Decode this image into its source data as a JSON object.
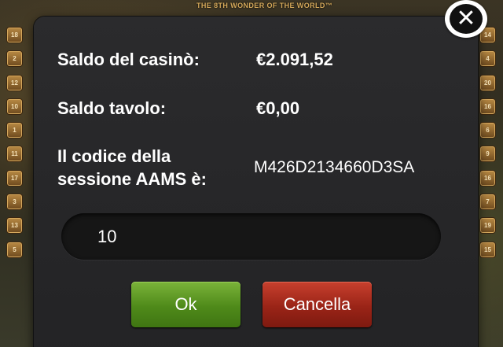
{
  "background": {
    "game_title": "THE 8TH WONDER OF THE WORLD™",
    "left_paylines": [
      "18",
      "2",
      "12",
      "10",
      "1",
      "11",
      "17",
      "3",
      "13",
      "5"
    ],
    "right_paylines": [
      "14",
      "4",
      "20",
      "16",
      "6",
      "9",
      "16",
      "7",
      "19",
      "15"
    ]
  },
  "dialog": {
    "close_icon": "✕",
    "casino_balance_label": "Saldo del casinò:",
    "casino_balance_value": "€2.091,52",
    "table_balance_label": "Saldo tavolo:",
    "table_balance_value": "€0,00",
    "session_code_label_line1": "Il codice della",
    "session_code_label_line2": "sessione AAMS è:",
    "session_code_value": "M426D2134660D3SA",
    "amount_input_value": "10",
    "ok_label": "Ok",
    "cancel_label": "Cancella"
  },
  "colors": {
    "ok_button": "#4f8a1a",
    "cancel_button": "#9a2417",
    "dialog_background": "#2b2b2d"
  }
}
